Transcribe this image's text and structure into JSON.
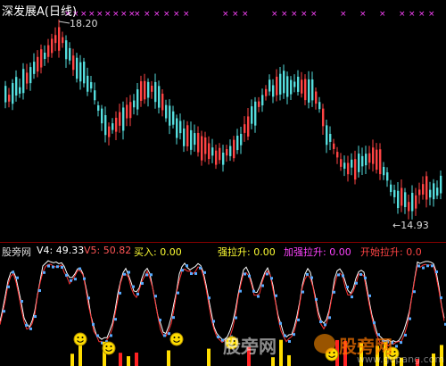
{
  "upper": {
    "title": "深发展A(日线)",
    "high_label": "18.20",
    "low_label": "←14.93",
    "colors": {
      "up": "#ff4444",
      "down": "#55dddd",
      "marker": "#ff44ff"
    }
  },
  "lower": {
    "indicator_name": "股旁网",
    "v4_label": "V4: 49.33",
    "v5_label": "V5: 50.82",
    "buy_label": "买入: 0.00",
    "strong_label": "强拉升: 0.00",
    "stronger_label": "加强拉升: 0.00",
    "start_label": "开始拉升: 0.0",
    "colors": {
      "v4": "#ffffff",
      "v5": "#ff3333",
      "buy": "#ffff00",
      "strong": "#ffff00",
      "stronger": "#ff33ff",
      "start": "#ff3333"
    }
  },
  "watermark": {
    "text": "股旁网",
    "url": "www.gupang.com"
  }
}
